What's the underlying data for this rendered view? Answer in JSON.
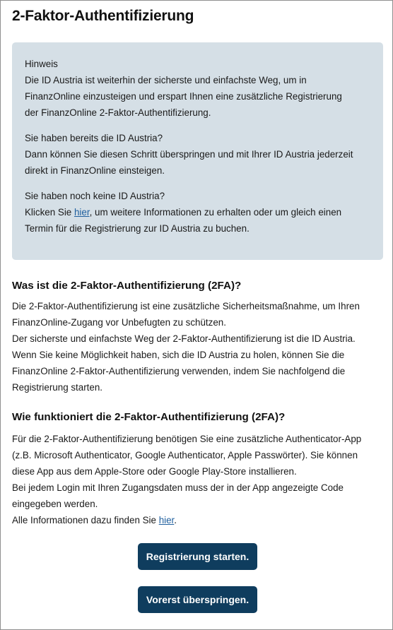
{
  "page": {
    "title": "2-Faktor-Authentifizierung"
  },
  "notice": {
    "heading": "Hinweis",
    "intro_lines": [
      "Die ID Austria ist weiterhin der sicherste und einfachste Weg, um in",
      "FinanzOnline einzusteigen und erspart Ihnen eine zusätzliche Registrierung",
      "der FinanzOnline 2-Faktor-Authentifizierung."
    ],
    "has_id_question": "Sie haben bereits die ID Austria?",
    "has_id_lines": [
      "Dann können Sie diesen Schritt überspringen und mit Ihrer ID Austria jederzeit",
      "direkt in FinanzOnline einsteigen."
    ],
    "no_id_question": "Sie haben noch keine ID Austria?",
    "no_id_prefix": "Klicken Sie ",
    "no_id_link": "hier",
    "no_id_suffix": ", um weitere Informationen zu erhalten oder um gleich einen",
    "no_id_line2": "Termin für die Registrierung zur ID Austria zu buchen."
  },
  "what_is": {
    "heading": "Was ist die 2-Faktor-Authentifizierung (2FA)?",
    "lines": [
      "Die 2-Faktor-Authentifizierung ist eine zusätzliche Sicherheitsmaßnahme, um Ihren",
      "FinanzOnline-Zugang vor Unbefugten zu schützen.",
      "Der sicherste und einfachste Weg der 2-Faktor-Authentifizierung ist die ID Austria.",
      "Wenn Sie keine Möglichkeit haben, sich die ID Austria zu holen, können Sie die",
      "FinanzOnline 2-Faktor-Authentifizierung verwenden, indem Sie nachfolgend die",
      "Registrierung starten."
    ]
  },
  "how_works": {
    "heading": "Wie funktioniert die 2-Faktor-Authentifizierung (2FA)?",
    "lines": [
      "Für die 2-Faktor-Authentifizierung benötigen Sie eine zusätzliche Authenticator-App",
      "(z.B. Microsoft Authenticator, Google Authenticator, Apple Passwörter). Sie können",
      "diese App aus dem Apple-Store oder Google Play-Store installieren.",
      "Bei jedem Login mit Ihren Zugangsdaten muss der in der App angezeigte Code",
      "eingegeben werden."
    ],
    "info_prefix": "Alle Informationen dazu finden Sie ",
    "info_link": "hier",
    "info_suffix": "."
  },
  "buttons": {
    "start_registration": "Registrierung starten.",
    "skip_for_now": "Vorerst überspringen."
  },
  "colors": {
    "notice_background": "#d5dfe6",
    "button_background": "#0f3d5e",
    "link": "#1f5f9e"
  }
}
